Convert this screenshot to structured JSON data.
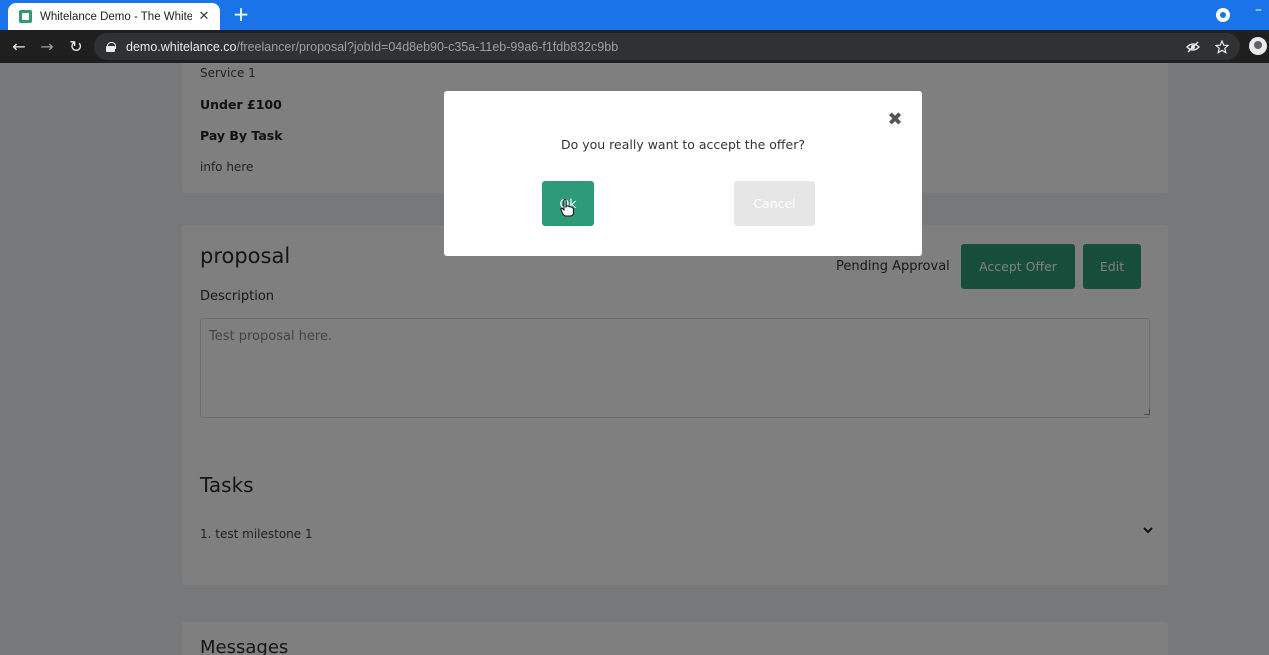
{
  "browser": {
    "tab_title": "Whitelance Demo - The White La",
    "tab_close": "✕",
    "new_tab": "+",
    "url_host": "demo.whitelance.co",
    "url_path": "/freelancer/proposal?jobId=04d8eb90-c35a-11eb-99a6-f1fdb832c9bb",
    "back": "←",
    "forward": "→",
    "reload": "↻",
    "icons": [
      "eye-off-icon",
      "star-icon",
      "incognito-profile-icon"
    ]
  },
  "service_card": {
    "service": "Service 1",
    "budget": "Under £100",
    "payment_type": "Pay By Task",
    "info": "info here"
  },
  "proposal": {
    "title": "proposal",
    "status": "Pending Approval",
    "accept_label": "Accept Offer",
    "edit_label": "Edit",
    "description_label": "Description",
    "description_placeholder": "Test proposal here.",
    "tasks_heading": "Tasks",
    "tasks": [
      "1. test milestone 1"
    ]
  },
  "messages": {
    "heading": "Messages"
  },
  "modal": {
    "close": "✖",
    "message": "Do you really want to accept the offer?",
    "ok_label": "Ok",
    "cancel_label": "Cancel"
  },
  "colors": {
    "accent": "#2e9a77",
    "browser_tab_bar": "#1a73e8",
    "toolbar": "#1f1f1f"
  }
}
